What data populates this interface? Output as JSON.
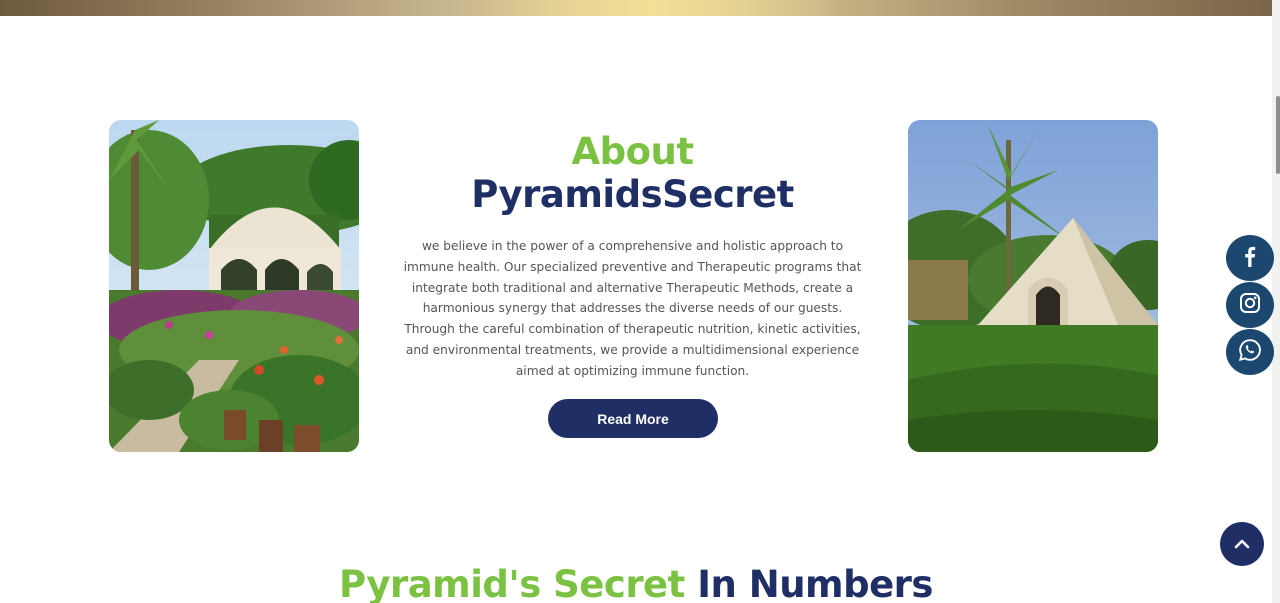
{
  "about": {
    "title_line1": "About",
    "title_line2": "PyramidsSecret",
    "body": "we believe in the power of a comprehensive and holistic approach to immune health. Our specialized preventive and Therapeutic programs that integrate both traditional and alternative Therapeutic Methods, create a harmonious synergy that addresses the diverse needs of our guests. Through the careful combination of therapeutic nutrition, kinetic activities, and environmental treatments, we provide a multidimensional experience aimed at optimizing immune function.",
    "read_more_label": "Read More"
  },
  "numbers": {
    "title_green": "Pyramid's Secret",
    "title_navy": "In Numbers"
  },
  "social": {
    "items": [
      "facebook-icon",
      "instagram-icon",
      "whatsapp-icon"
    ],
    "color": "#1c4870"
  },
  "colors": {
    "accent_green": "#7cc242",
    "brand_navy": "#1f2f66",
    "body_text": "#555555"
  }
}
